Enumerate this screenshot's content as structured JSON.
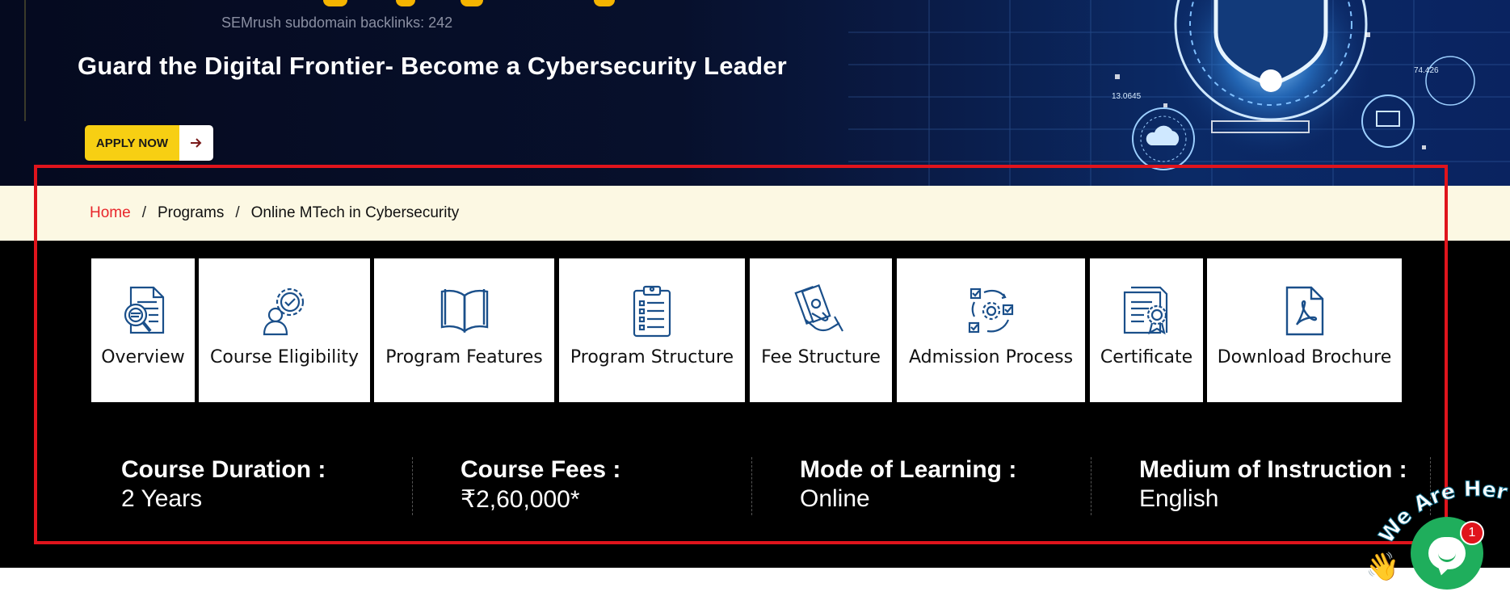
{
  "hero": {
    "semrush_text": "SEMrush subdomain backlinks: 242",
    "title": "Guard the Digital Frontier- Become a Cybersecurity Leader",
    "apply_label": "APPLY NOW",
    "art_labels": [
      "13.0645",
      "74.426"
    ]
  },
  "breadcrumb": {
    "home": "Home",
    "separator": "/",
    "programs": "Programs",
    "current": "Online MTech in Cybersecurity"
  },
  "tabs": [
    {
      "label": "Overview",
      "icon": "document-magnifier-icon"
    },
    {
      "label": "Course Eligibility",
      "icon": "person-gear-check-icon"
    },
    {
      "label": "Program Features",
      "icon": "open-book-icon"
    },
    {
      "label": "Program Structure",
      "icon": "clipboard-list-icon"
    },
    {
      "label": "Fee Structure",
      "icon": "hand-cash-icon"
    },
    {
      "label": "Admission Process",
      "icon": "process-cycle-icon"
    },
    {
      "label": "Certificate",
      "icon": "certificate-icon"
    },
    {
      "label": "Download Brochure",
      "icon": "pdf-file-icon"
    }
  ],
  "info": [
    {
      "key": "Course Duration :",
      "value": "2 Years"
    },
    {
      "key": "Course Fees :",
      "value": "₹2,60,000*"
    },
    {
      "key": "Mode of Learning :",
      "value": "Online"
    },
    {
      "key": "Medium of Instruction :",
      "value": "English"
    }
  ],
  "chat": {
    "tagline": "We Are Here!",
    "badge_count": "1",
    "wave": "👋"
  },
  "colors": {
    "accent_red": "#e8262b",
    "apply_yellow": "#f7cf13",
    "icon_blue": "#1a4f8a",
    "chat_green": "#1fae5c"
  }
}
